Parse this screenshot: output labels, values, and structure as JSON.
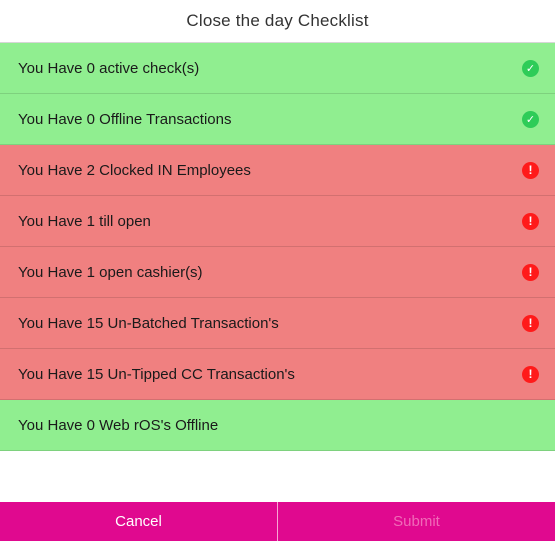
{
  "dialog": {
    "title": "Close the day Checklist"
  },
  "checklist": [
    {
      "label": "You Have 0 active check(s)",
      "status": "ok",
      "icon": "check-circle-icon"
    },
    {
      "label": "You Have 0 Offline Transactions",
      "status": "ok",
      "icon": "check-circle-icon"
    },
    {
      "label": "You Have 2 Clocked IN Employees",
      "status": "warn",
      "icon": "alert-circle-icon"
    },
    {
      "label": "You Have 1 till open",
      "status": "warn",
      "icon": "alert-circle-icon"
    },
    {
      "label": "You Have 1 open cashier(s)",
      "status": "warn",
      "icon": "alert-circle-icon"
    },
    {
      "label": "You Have 15 Un-Batched Transaction's",
      "status": "warn",
      "icon": "alert-circle-icon"
    },
    {
      "label": "You Have 15 Un-Tipped CC Transaction's",
      "status": "warn",
      "icon": "alert-circle-icon"
    },
    {
      "label": "You Have 0 Web rOS's Offline",
      "status": "ok",
      "icon": null
    }
  ],
  "footer": {
    "cancel_label": "Cancel",
    "submit_label": "Submit",
    "submit_disabled": true
  },
  "colors": {
    "ok_row": "#90ee90",
    "warn_row": "#f08080",
    "check_icon": "#2ecc58",
    "alert_icon": "#ff1a1a",
    "button_bg": "#e0098f"
  }
}
